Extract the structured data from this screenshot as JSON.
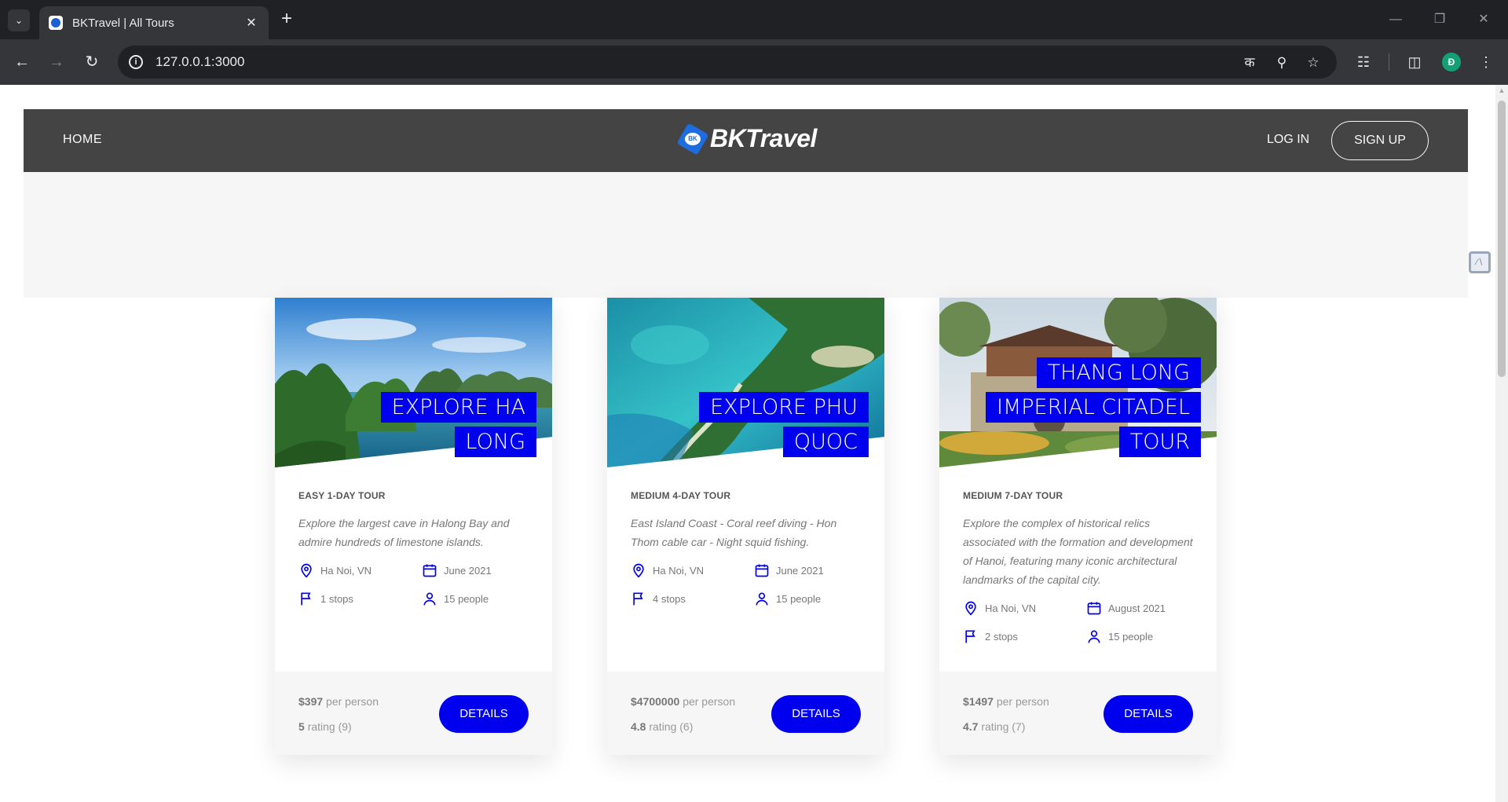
{
  "browser": {
    "tab_title": "BKTravel | All Tours",
    "url": "127.0.0.1:3000",
    "profile_initial": "Đ"
  },
  "header": {
    "home": "HOME",
    "brand": "BKTravel",
    "logo_badge": "BK",
    "login": "LOG IN",
    "signup": "SIGN UP"
  },
  "tours": [
    {
      "title": "EXPLORE HA LONG",
      "subheading": "EASY 1-DAY TOUR",
      "summary": "Explore the largest cave in Halong Bay and admire hundreds of limestone islands.",
      "location": "Ha Noi, VN",
      "date": "June 2021",
      "stops": "1 stops",
      "group": "15 people",
      "price_value": "$397",
      "price_unit": "per person",
      "rating_value": "5",
      "rating_text": "rating (9)",
      "button": "DETAILS"
    },
    {
      "title": "EXPLORE PHU QUOC",
      "subheading": "MEDIUM 4-DAY TOUR",
      "summary": "East Island Coast - Coral reef diving - Hon Thom cable car - Night squid fishing.",
      "location": "Ha Noi, VN",
      "date": "June 2021",
      "stops": "4 stops",
      "group": "15 people",
      "price_value": "$4700000",
      "price_unit": "per person",
      "rating_value": "4.8",
      "rating_text": "rating (6)",
      "button": "DETAILS"
    },
    {
      "title": "THANG LONG IMPERIAL CITADEL TOUR",
      "subheading": "MEDIUM 7-DAY TOUR",
      "summary": "Explore the complex of historical relics associated with the formation and development of Hanoi, featuring many iconic architectural landmarks of the capital city.",
      "location": "Ha Noi, VN",
      "date": "August 2021",
      "stops": "2 stops",
      "group": "15 people",
      "price_value": "$1497",
      "price_unit": "per person",
      "rating_value": "4.7",
      "rating_text": "rating (7)",
      "button": "DETAILS"
    }
  ],
  "colors": {
    "accent": "#0000ee",
    "header_bg": "#444444",
    "band_bg": "#f6f6f6"
  }
}
